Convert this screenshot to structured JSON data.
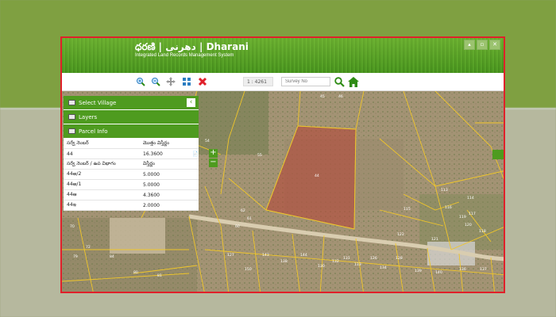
{
  "header": {
    "title": "ధరణి | دھرنی | Dharani",
    "subtitle": "Integrated Land Records Management System"
  },
  "window_buttons": [
    "▴",
    "▫",
    "✕"
  ],
  "toolbar": {
    "scale_value": "1 : 4261",
    "search_placeholder": "Survey No",
    "icons": [
      "zoom-in-icon",
      "zoom-out-icon",
      "pan-icon",
      "full-extent-icon",
      "clear-icon",
      "search-icon",
      "home-icon"
    ],
    "accent_color": "#2e8b14",
    "clear_color": "#e0202a"
  },
  "panel": {
    "select_village": "Select Village",
    "layers": "Layers",
    "parcel_info": "Parcel Info",
    "rows": [
      [
        "సర్వే నెంబర్",
        "మొత్తం విస్తీర్ణం"
      ],
      [
        "44",
        "16.3600"
      ],
      [
        "సర్వే నెంబర్ / ఉప విభాగం",
        "విస్తీర్ణం"
      ],
      [
        "44అ/2",
        "5.0000"
      ],
      [
        "44అ/1",
        "5.0000"
      ],
      [
        "44ఆ",
        "4.3600"
      ],
      [
        "44ఇ",
        "2.0000"
      ]
    ]
  },
  "map": {
    "zoom_in": "+",
    "zoom_out": "−",
    "parcel_labels": [
      {
        "t": "45"
      },
      {
        "t": "46"
      },
      {
        "t": "55"
      },
      {
        "t": "44"
      },
      {
        "t": "54"
      },
      {
        "t": "62"
      },
      {
        "t": "61"
      },
      {
        "t": "60"
      },
      {
        "t": "113"
      },
      {
        "t": "119"
      },
      {
        "t": "116"
      },
      {
        "t": "117"
      },
      {
        "t": "118"
      },
      {
        "t": "122"
      },
      {
        "t": "120"
      },
      {
        "t": "115"
      },
      {
        "t": "114"
      },
      {
        "t": "121"
      },
      {
        "t": "126"
      },
      {
        "t": "131"
      },
      {
        "t": "132"
      },
      {
        "t": "130"
      },
      {
        "t": "133"
      },
      {
        "t": "134"
      },
      {
        "t": "128"
      },
      {
        "t": "139"
      },
      {
        "t": "140"
      },
      {
        "t": "136"
      },
      {
        "t": "137"
      },
      {
        "t": "144"
      },
      {
        "t": "138"
      },
      {
        "t": "143"
      },
      {
        "t": "150"
      },
      {
        "t": "127"
      },
      {
        "t": "79"
      },
      {
        "t": "70"
      },
      {
        "t": "72"
      },
      {
        "t": "84"
      },
      {
        "t": "80"
      },
      {
        "t": "81"
      }
    ]
  }
}
